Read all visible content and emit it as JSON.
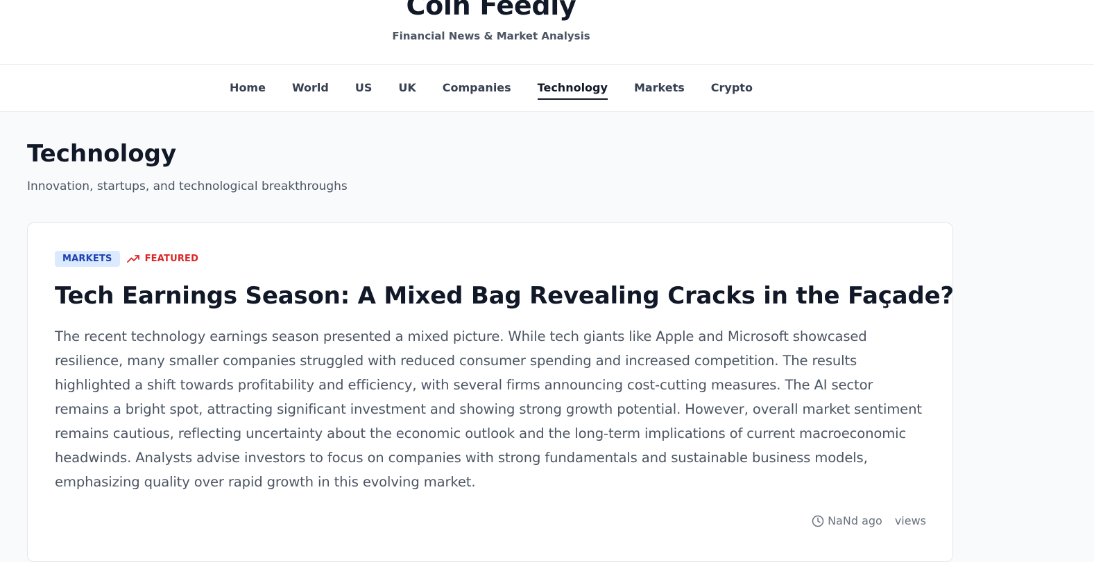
{
  "header": {
    "site_title": "Coin Feedly",
    "site_subtitle": "Financial News & Market Analysis"
  },
  "nav": {
    "items": [
      {
        "label": "Home"
      },
      {
        "label": "World"
      },
      {
        "label": "US"
      },
      {
        "label": "UK"
      },
      {
        "label": "Companies"
      },
      {
        "label": "Technology"
      },
      {
        "label": "Markets"
      },
      {
        "label": "Crypto"
      }
    ],
    "active": "Technology"
  },
  "page": {
    "title": "Technology",
    "description": "Innovation, startups, and technological breakthroughs"
  },
  "featured_article": {
    "category": "MARKETS",
    "featured_label": "FEATURED",
    "featured_icon": "trending-up-icon",
    "title": "Tech Earnings Season: A Mixed Bag Revealing Cracks in the Façade?",
    "summary": "The recent technology earnings season presented a mixed picture. While tech giants like Apple and Microsoft showcased resilience, many smaller companies struggled with reduced consumer spending and increased competition. The results highlighted a shift towards profitability and efficiency, with several firms announcing cost-cutting measures. The AI sector remains a bright spot, attracting significant investment and showing strong growth potential. However, overall market sentiment remains cautious, reflecting uncertainty about the economic outlook and the long-term implications of current macroeconomic headwinds. Analysts advise investors to focus on companies with strong fundamentals and sustainable business models, emphasizing quality over rapid growth in this evolving market.",
    "time_icon": "clock-icon",
    "time_ago": "NaNd ago",
    "views": "views"
  },
  "colors": {
    "accent_badge_bg": "#dbeafe",
    "accent_badge_text": "#1e40af",
    "featured_red": "#dc2626",
    "text_primary": "#111827",
    "text_secondary": "#4b5563"
  }
}
